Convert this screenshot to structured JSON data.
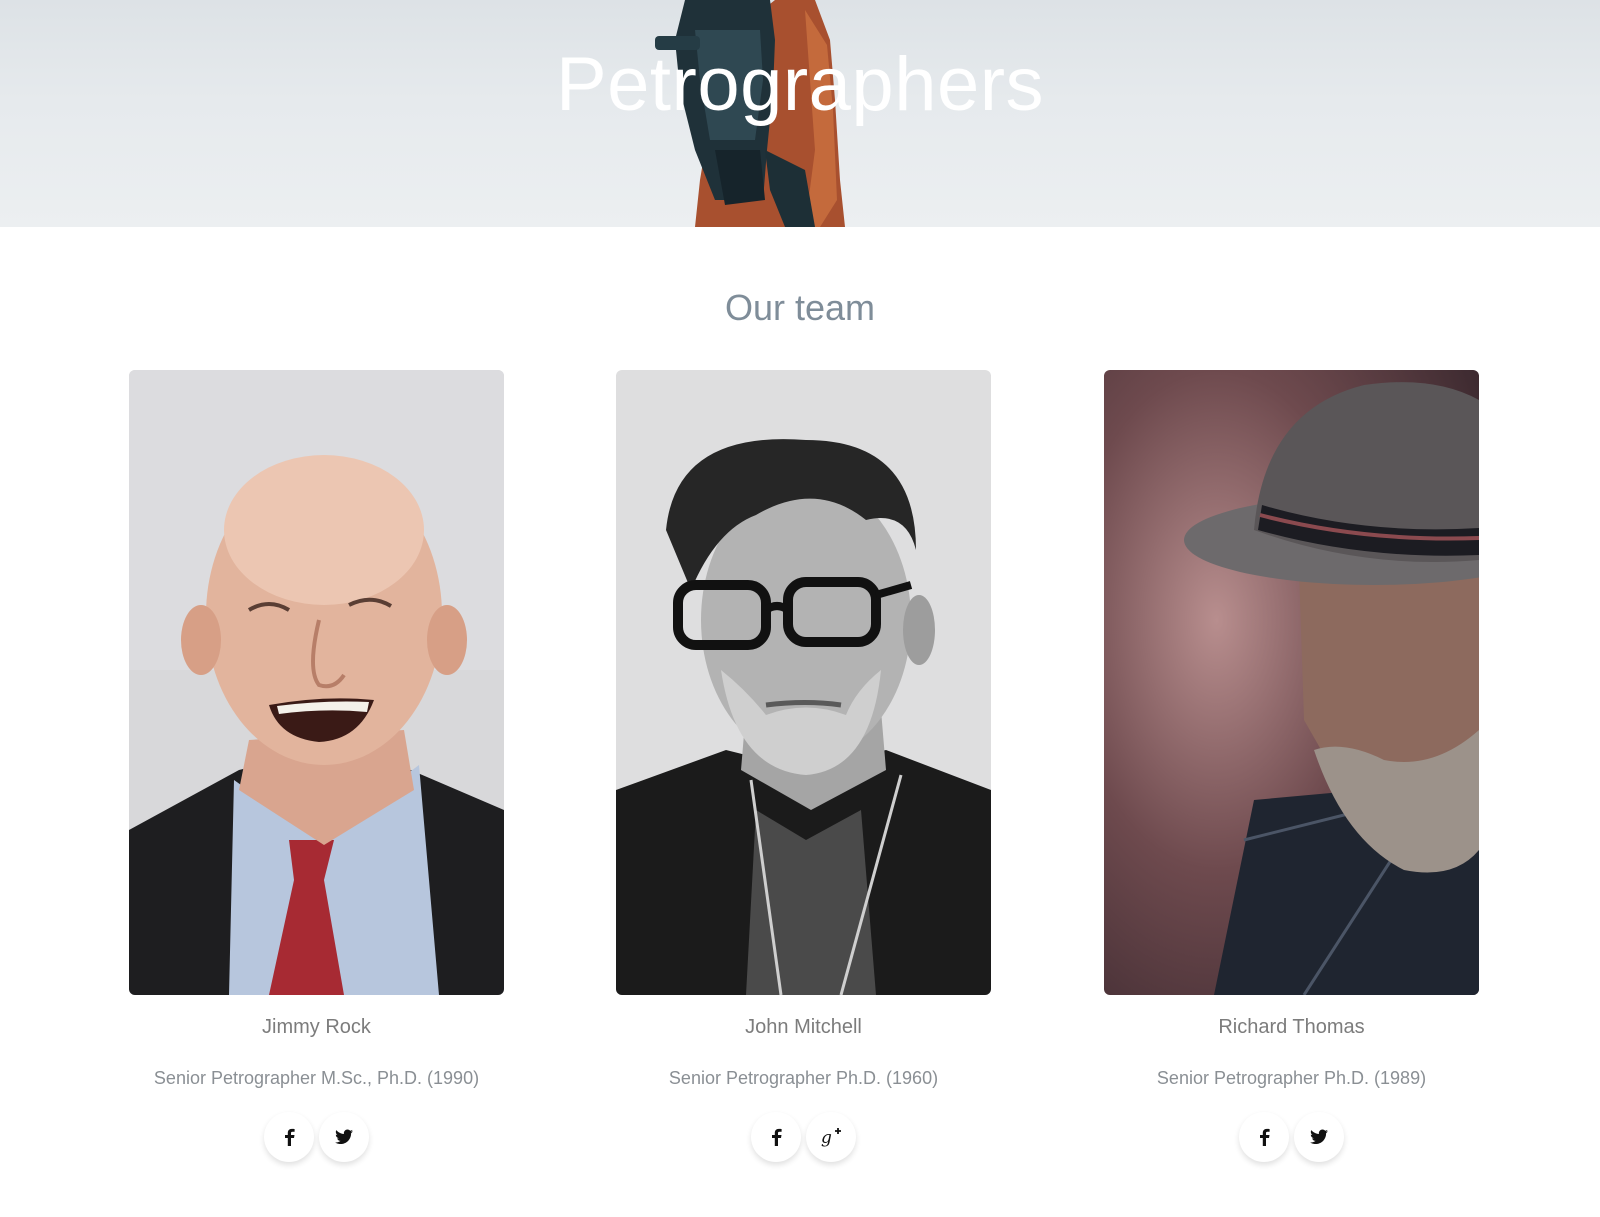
{
  "hero": {
    "title": "Petrographers"
  },
  "team": {
    "heading": "Our team",
    "members": [
      {
        "name": "Jimmy Rock",
        "role": "Senior Petrographer M.Sc., Ph.D. (1990)",
        "social": [
          "facebook-icon",
          "twitter-icon"
        ]
      },
      {
        "name": "John Mitchell",
        "role": "Senior Petrographer Ph.D. (1960)",
        "social": [
          "facebook-icon",
          "google-plus-icon"
        ]
      },
      {
        "name": "Richard Thomas",
        "role": "Senior Petrographer Ph.D. (1989)",
        "social": [
          "facebook-icon",
          "twitter-icon"
        ]
      }
    ]
  },
  "colors": {
    "heading": "#7f8d99",
    "name": "#7c7c7c",
    "role": "#8a8f94",
    "hero_title": "#ffffff"
  }
}
